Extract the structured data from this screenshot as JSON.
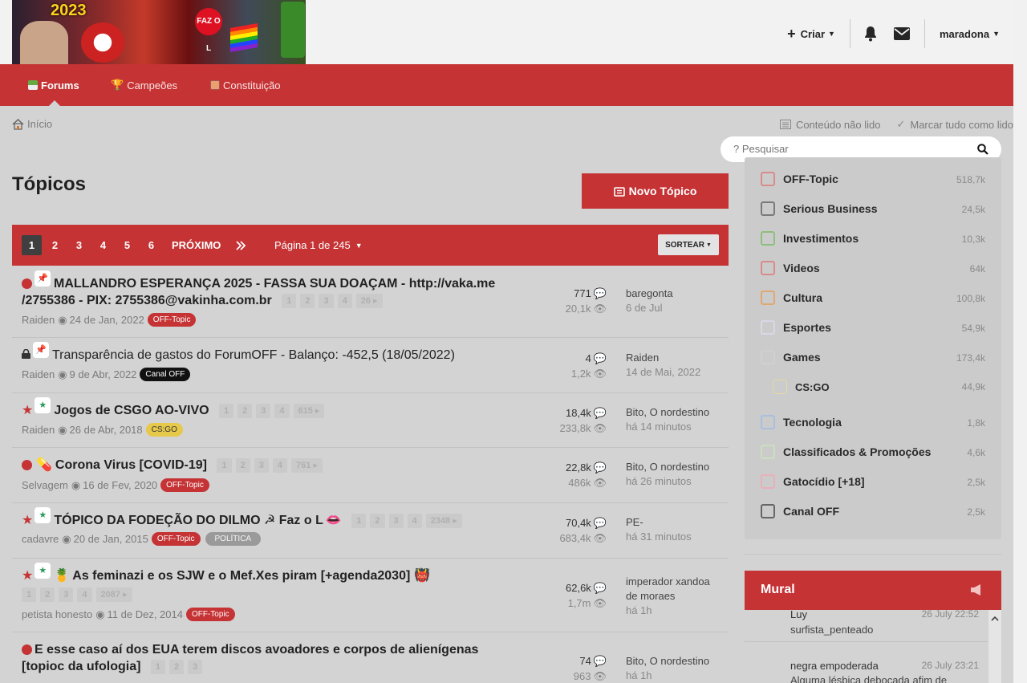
{
  "banner": {
    "year": "2023",
    "badge": "FAZ O L"
  },
  "header": {
    "create_label": "Criar",
    "user_label": "maradona"
  },
  "nav": {
    "tabs": [
      {
        "label": "Forums"
      },
      {
        "label": "Campeões"
      },
      {
        "label": "Constituição"
      }
    ],
    "search_placeholder": "? Pesquisar"
  },
  "breadcrumb": {
    "home": "Início",
    "unread": "Conteúdo não lido",
    "mark_read": "Marcar tudo como lido"
  },
  "main": {
    "title": "Tópicos",
    "new_topic_label": "Novo Tópico",
    "pagination": {
      "pages": [
        "1",
        "2",
        "3",
        "4",
        "5",
        "6"
      ],
      "current": "1",
      "next": "PRÓXIMO",
      "page_of": "Página 1 de 245",
      "sort": "SORTEAR"
    },
    "topics": [
      {
        "title_l1": "MALLANDRO ESPERANÇA 2025 - FASSA SUA DOAÇAM - http://vaka.me",
        "title_l2": "/2755386 - PIX: 2755386@vakinha.com.br",
        "pages": [
          "1",
          "2",
          "3",
          "4",
          "26"
        ],
        "author": "Raiden",
        "date": "24 de Jan, 2022",
        "tag": "OFF-Topic",
        "replies": "771",
        "views": "20,1k",
        "last_user": "baregonta",
        "last_time": "6 de Jul"
      },
      {
        "title": "Transparência de gastos do ForumOFF - Balanço: -452,5 (18/05/2022)",
        "author": "Raiden",
        "date": "9 de Abr, 2022",
        "tag": "Canal OFF",
        "replies": "4",
        "views": "1,2k",
        "last_user": "Raiden",
        "last_time": "14 de Mai, 2022"
      },
      {
        "title": "Jogos de CSGO AO-VIVO",
        "pages": [
          "1",
          "2",
          "3",
          "4",
          "615"
        ],
        "author": "Raiden",
        "date": "26 de Abr, 2018",
        "tag": "CS:GO",
        "replies": "18,4k",
        "views": "233,8k",
        "last_user": "Bito, O nordestino",
        "last_time": "há 14 minutos"
      },
      {
        "title": "Corona Virus [COVID-19]",
        "pages": [
          "1",
          "2",
          "3",
          "4",
          "761"
        ],
        "author": "Selvagem",
        "date": "16 de Fev, 2020",
        "tag": "OFF-Topic",
        "replies": "22,8k",
        "views": "486k",
        "last_user": "Bito, O nordestino",
        "last_time": "há 26 minutos"
      },
      {
        "title": "TÓPICO DA FODEÇÃO DO DILMO ☭ Faz o L",
        "pages": [
          "1",
          "2",
          "3",
          "4",
          "2348"
        ],
        "author": "cadavre",
        "date": "20 de Jan, 2015",
        "tag": "OFF-Topic",
        "tag2": "POLÍTICA",
        "replies": "70,4k",
        "views": "683,4k",
        "last_user": "PE-",
        "last_time": "há 31 minutos"
      },
      {
        "title": "As feminazi e os SJW e o Mef.Xes piram [+agenda2030]",
        "pages": [
          "1",
          "2",
          "3",
          "4",
          "2087"
        ],
        "author": "petista honesto",
        "date": "11 de Dez, 2014",
        "tag": "OFF-Topic",
        "replies": "62,6k",
        "views": "1,7m",
        "last_user_l1": "imperador xandoa",
        "last_user_l2": "de moraes",
        "last_time": "há 1h"
      },
      {
        "title_l1": "E esse caso aí dos EUA terem discos avoadores e corpos de alienígenas",
        "title_l2": "[topioc da ufologia]",
        "pages": [
          "1",
          "2",
          "3"
        ],
        "replies": "74",
        "views": "963",
        "last_user": "Bito, O nordestino",
        "last_time": "há 1h"
      }
    ]
  },
  "sidebar": {
    "categories": [
      {
        "name": "OFF-Topic",
        "count": "518,7k",
        "color": "#d98b8b"
      },
      {
        "name": "Serious Business",
        "count": "24,5k",
        "color": "#7a7a7a"
      },
      {
        "name": "Investimentos",
        "count": "10,3k",
        "color": "#8fbf7f"
      },
      {
        "name": "Videos",
        "count": "64k",
        "color": "#d98b8b"
      },
      {
        "name": "Cultura",
        "count": "100,8k",
        "color": "#e0a870"
      },
      {
        "name": "Esportes",
        "count": "54,9k",
        "color": "#d8d8e6"
      },
      {
        "name": "Games",
        "count": "173,4k",
        "color": "#d0d0d0"
      },
      {
        "name": "CS:GO",
        "count": "44,9k",
        "color": "#e6d9a0"
      },
      {
        "name": "Tecnologia",
        "count": "1,8k",
        "color": "#a8bfe0"
      },
      {
        "name": "Classificados & Promoções",
        "count": "4,6k",
        "color": "#c8e0c0"
      },
      {
        "name": "Gatocídio [+18]",
        "count": "2,5k",
        "color": "#e8b0b8"
      },
      {
        "name": "Canal OFF",
        "count": "2,5k",
        "color": "#666666"
      }
    ]
  },
  "mural": {
    "title": "Mural",
    "messages": [
      {
        "user": "Luy",
        "date": "26 July 22:52",
        "text": "surfista_penteado"
      },
      {
        "user": "negra empoderada",
        "date": "26 July 23:21",
        "text": "Alguma lésbica debocada afim de"
      }
    ]
  },
  "colors": {
    "accent": "#c53335",
    "background": "#d3d3d3",
    "topbar": "#f2f2f2"
  }
}
